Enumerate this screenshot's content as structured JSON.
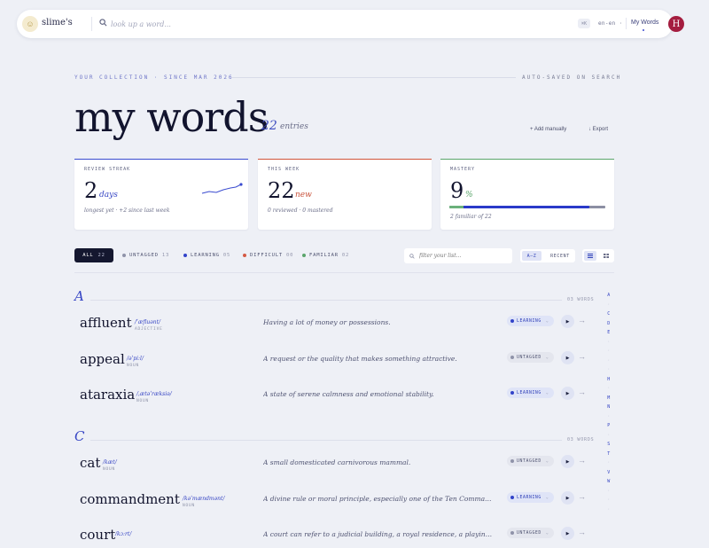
{
  "nav": {
    "brand": "slime's",
    "search_placeholder": "look up a word...",
    "kbd_hint": "⌘K",
    "language": "en-en ·",
    "my_words": "My Words",
    "avatar_initial": "H"
  },
  "header": {
    "eyebrow_left": "YOUR COLLECTION · SINCE MAR 2026",
    "eyebrow_right": "AUTO-SAVED ON SEARCH",
    "title": "my words",
    "entry_count": "22",
    "entry_label": "entries",
    "add_manually": "+ Add manually",
    "export": "↓ Export"
  },
  "stats": [
    {
      "label": "REVIEW STREAK",
      "value": "2",
      "unit": "days",
      "sub": "longest yet · +2 since last week",
      "accent": "#3a4bd0"
    },
    {
      "label": "THIS WEEK",
      "value": "22",
      "unit": "new",
      "sub": "0 reviewed · 0 mastered",
      "accent": "#d0543a"
    },
    {
      "label": "MASTERY",
      "value": "9",
      "unit": "%",
      "sub": "2 familiar of 22",
      "accent": "#5aa56b",
      "progress": 0.9
    }
  ],
  "filters": {
    "all_label": "ALL",
    "all_count": "22",
    "items": [
      {
        "label": "UNTAGGED",
        "count": "13",
        "color": "#8f93a9"
      },
      {
        "label": "LEARNING",
        "count": "05",
        "color": "#3243c9"
      },
      {
        "label": "DIFFICULT",
        "count": "00",
        "color": "#d45a45"
      },
      {
        "label": "FAMILIAR",
        "count": "02",
        "color": "#5aa56b"
      }
    ],
    "search_placeholder": "filter your list...",
    "sort_az": "A–Z",
    "sort_recent": "RECENT"
  },
  "sections": [
    {
      "letter": "A",
      "count": "03 WORDS",
      "words": [
        {
          "word": "affluent",
          "ipa": "/ˈæfluənt/",
          "pos": "ADJECTIVE",
          "definition": "Having a lot of money or possessions.",
          "tag": "LEARNING"
        },
        {
          "word": "appeal",
          "ipa": "/əˈpiːl/",
          "pos": "NOUN",
          "definition": "A request or the quality that makes something attractive.",
          "tag": "UNTAGGED"
        },
        {
          "word": "ataraxia",
          "ipa": "/ˌætəˈræksiə/",
          "pos": "NOUN",
          "definition": "A state of serene calmness and emotional stability.",
          "tag": "LEARNING"
        }
      ]
    },
    {
      "letter": "C",
      "count": "03 WORDS",
      "words": [
        {
          "word": "cat",
          "ipa": "/kæt/",
          "pos": "NOUN",
          "definition": "A small domesticated carnivorous mammal.",
          "tag": "UNTAGGED"
        },
        {
          "word": "commandment",
          "ipa": "/kəˈmændmənt/",
          "pos": "NOUN",
          "definition": "A divine rule or moral principle, especially one of the Ten Commandments.",
          "tag": "LEARNING"
        },
        {
          "word": "court",
          "ipa": "/kɔːrt/",
          "pos": "NOUN",
          "definition": "A court can refer to a judicial building, a royal residence, a playing area for sports.",
          "tag": "UNTAGGED"
        }
      ]
    }
  ],
  "alphabet": {
    "active": [
      "A",
      "C",
      "D",
      "E",
      "H",
      "M",
      "N",
      "P",
      "S",
      "T",
      "V",
      "W"
    ],
    "inactive_marks": "·"
  }
}
